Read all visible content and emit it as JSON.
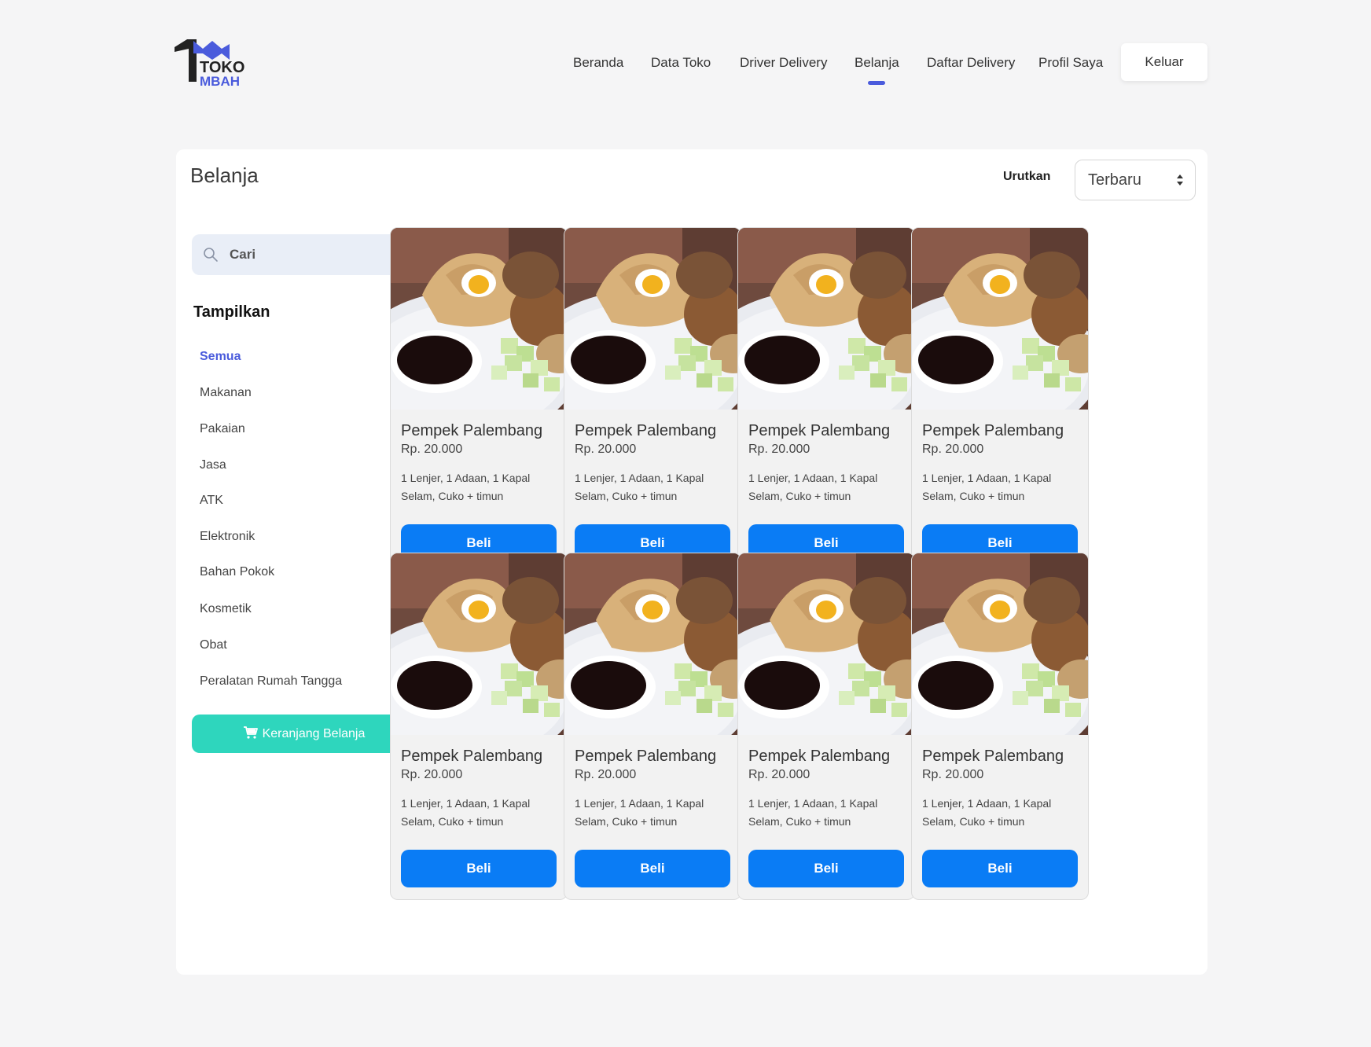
{
  "brand": {
    "line1": "TOKO",
    "line2": "MBAH",
    "color_dark": "#222222",
    "color_accent": "#4a5bdc"
  },
  "nav": {
    "items": [
      {
        "label": "Beranda",
        "active": false
      },
      {
        "label": "Data Toko",
        "active": false
      },
      {
        "label": "Driver Delivery",
        "active": false
      },
      {
        "label": "Belanja",
        "active": true
      },
      {
        "label": "Daftar Delivery",
        "active": false
      },
      {
        "label": "Profil Saya",
        "active": false
      }
    ],
    "logout_label": "Keluar"
  },
  "page": {
    "title": "Belanja",
    "sort_label": "Urutkan",
    "sort_value": "Terbaru"
  },
  "sidebar": {
    "search_placeholder": "Cari",
    "filter_title": "Tampilkan",
    "categories": [
      {
        "label": "Semua",
        "active": true
      },
      {
        "label": "Makanan",
        "active": false
      },
      {
        "label": "Pakaian",
        "active": false
      },
      {
        "label": "Jasa",
        "active": false
      },
      {
        "label": "ATK",
        "active": false
      },
      {
        "label": "Elektronik",
        "active": false
      },
      {
        "label": "Bahan Pokok",
        "active": false
      },
      {
        "label": "Kosmetik",
        "active": false
      },
      {
        "label": "Obat",
        "active": false
      },
      {
        "label": "Peralatan Rumah Tangga",
        "active": false
      }
    ],
    "cart_label": "Keranjang Belanja"
  },
  "products": [
    {
      "name": "Pempek Palembang",
      "price": "Rp. 20.000",
      "desc": "1 Lenjer, 1 Adaan, 1 Kapal Selam, Cuko + timun",
      "buy_label": "Beli"
    },
    {
      "name": "Pempek Palembang",
      "price": "Rp. 20.000",
      "desc": "1 Lenjer, 1 Adaan, 1 Kapal Selam, Cuko + timun",
      "buy_label": "Beli"
    },
    {
      "name": "Pempek Palembang",
      "price": "Rp. 20.000",
      "desc": "1 Lenjer, 1 Adaan, 1 Kapal Selam, Cuko + timun",
      "buy_label": "Beli"
    },
    {
      "name": "Pempek Palembang",
      "price": "Rp. 20.000",
      "desc": "1 Lenjer, 1 Adaan, 1 Kapal Selam, Cuko + timun",
      "buy_label": "Beli"
    },
    {
      "name": "Pempek Palembang",
      "price": "Rp. 20.000",
      "desc": "1 Lenjer, 1 Adaan, 1 Kapal Selam, Cuko + timun",
      "buy_label": "Beli"
    },
    {
      "name": "Pempek Palembang",
      "price": "Rp. 20.000",
      "desc": "1 Lenjer, 1 Adaan, 1 Kapal Selam, Cuko + timun",
      "buy_label": "Beli"
    },
    {
      "name": "Pempek Palembang",
      "price": "Rp. 20.000",
      "desc": "1 Lenjer, 1 Adaan, 1 Kapal Selam, Cuko + timun",
      "buy_label": "Beli"
    },
    {
      "name": "Pempek Palembang",
      "price": "Rp. 20.000",
      "desc": "1 Lenjer, 1 Adaan, 1 Kapal Selam, Cuko + timun",
      "buy_label": "Beli"
    }
  ],
  "colors": {
    "buy_button": "#0a7cf5",
    "cart_button": "#2ed6bd",
    "accent": "#4a5bdc"
  }
}
